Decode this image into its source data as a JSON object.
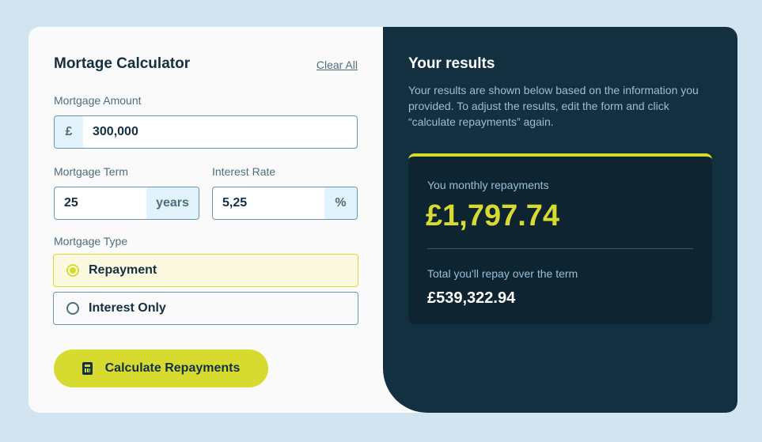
{
  "calculator": {
    "title": "Mortage Calculator",
    "clear_all": "Clear All",
    "amount": {
      "label": "Mortgage Amount",
      "prefix": "£",
      "value": "300,000"
    },
    "term": {
      "label": "Mortgage Term",
      "value": "25",
      "suffix": "years"
    },
    "rate": {
      "label": "Interest Rate",
      "value": "5,25",
      "suffix": "%"
    },
    "type": {
      "label": "Mortgage Type",
      "options": [
        {
          "label": "Repayment",
          "selected": true
        },
        {
          "label": "Interest Only",
          "selected": false
        }
      ]
    },
    "calculate_button": {
      "label": "Calculate Repayments",
      "icon": "calculator-icon"
    }
  },
  "results": {
    "title": "Your results",
    "description": "Your results are shown below based on the information you provided. To adjust the results, edit the form and click “calculate repayments” again.",
    "monthly_label": "You monthly repayments",
    "monthly_value": "£1,797.74",
    "total_label": "Total you'll repay over the term",
    "total_value": "£539,322.94"
  },
  "colors": {
    "background": "#d1e4ef",
    "dark": "#133041",
    "accent": "#d8db2f",
    "slate": "#4e6e7e"
  }
}
